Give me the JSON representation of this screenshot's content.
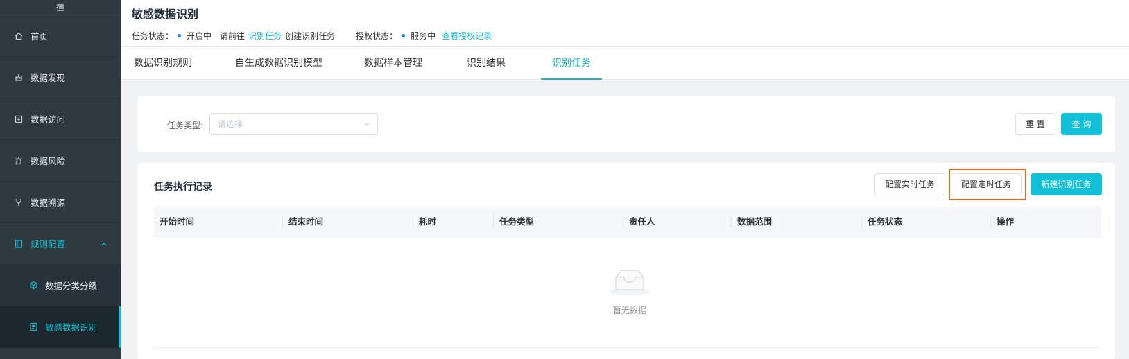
{
  "sidebar": {
    "items": [
      {
        "label": "首页",
        "icon": "home-icon"
      },
      {
        "label": "数据发现",
        "icon": "discover-icon"
      },
      {
        "label": "数据访问",
        "icon": "access-icon"
      },
      {
        "label": "数据风险",
        "icon": "alarm-icon"
      },
      {
        "label": "数据溯源",
        "icon": "branch-icon"
      },
      {
        "label": "规则配置",
        "icon": "rules-icon",
        "expanded": true
      }
    ],
    "sub_items": [
      {
        "label": "数据分类分级",
        "icon": "cube-icon"
      },
      {
        "label": "敏感数据识别",
        "icon": "document-icon",
        "active": true
      }
    ]
  },
  "header": {
    "title": "敏感数据识别",
    "task_status_label": "任务状态：",
    "task_status_value": "开启中",
    "goto_prefix": "请前往",
    "goto_link": "识别任务",
    "goto_suffix": "创建识别任务",
    "auth_status_label": "授权状态：",
    "auth_status_value": "服务中",
    "auth_link": "查看授权记录"
  },
  "tabs": [
    {
      "label": "数据识别规则"
    },
    {
      "label": "自生成数据识别模型"
    },
    {
      "label": "数据样本管理"
    },
    {
      "label": "识别结果"
    },
    {
      "label": "识别任务",
      "active": true
    }
  ],
  "filter": {
    "task_type_label": "任务类型:",
    "task_type_placeholder": "请选择",
    "reset_label": "重 置",
    "search_label": "查 询"
  },
  "records": {
    "title": "任务执行记录",
    "config_realtime_label": "配置实时任务",
    "config_scheduled_label": "配置定时任务",
    "new_task_label": "新建识别任务",
    "columns": [
      "开始时间",
      "结束时间",
      "耗时",
      "任务类型",
      "责任人",
      "数据范围",
      "任务状态",
      "操作"
    ],
    "empty_text": "暂无数据"
  },
  "colors": {
    "accent": "#12c0d8",
    "sidebar_bg": "#2f3a40",
    "highlight": "#ec6420",
    "status_dot": "#1e80ff"
  }
}
